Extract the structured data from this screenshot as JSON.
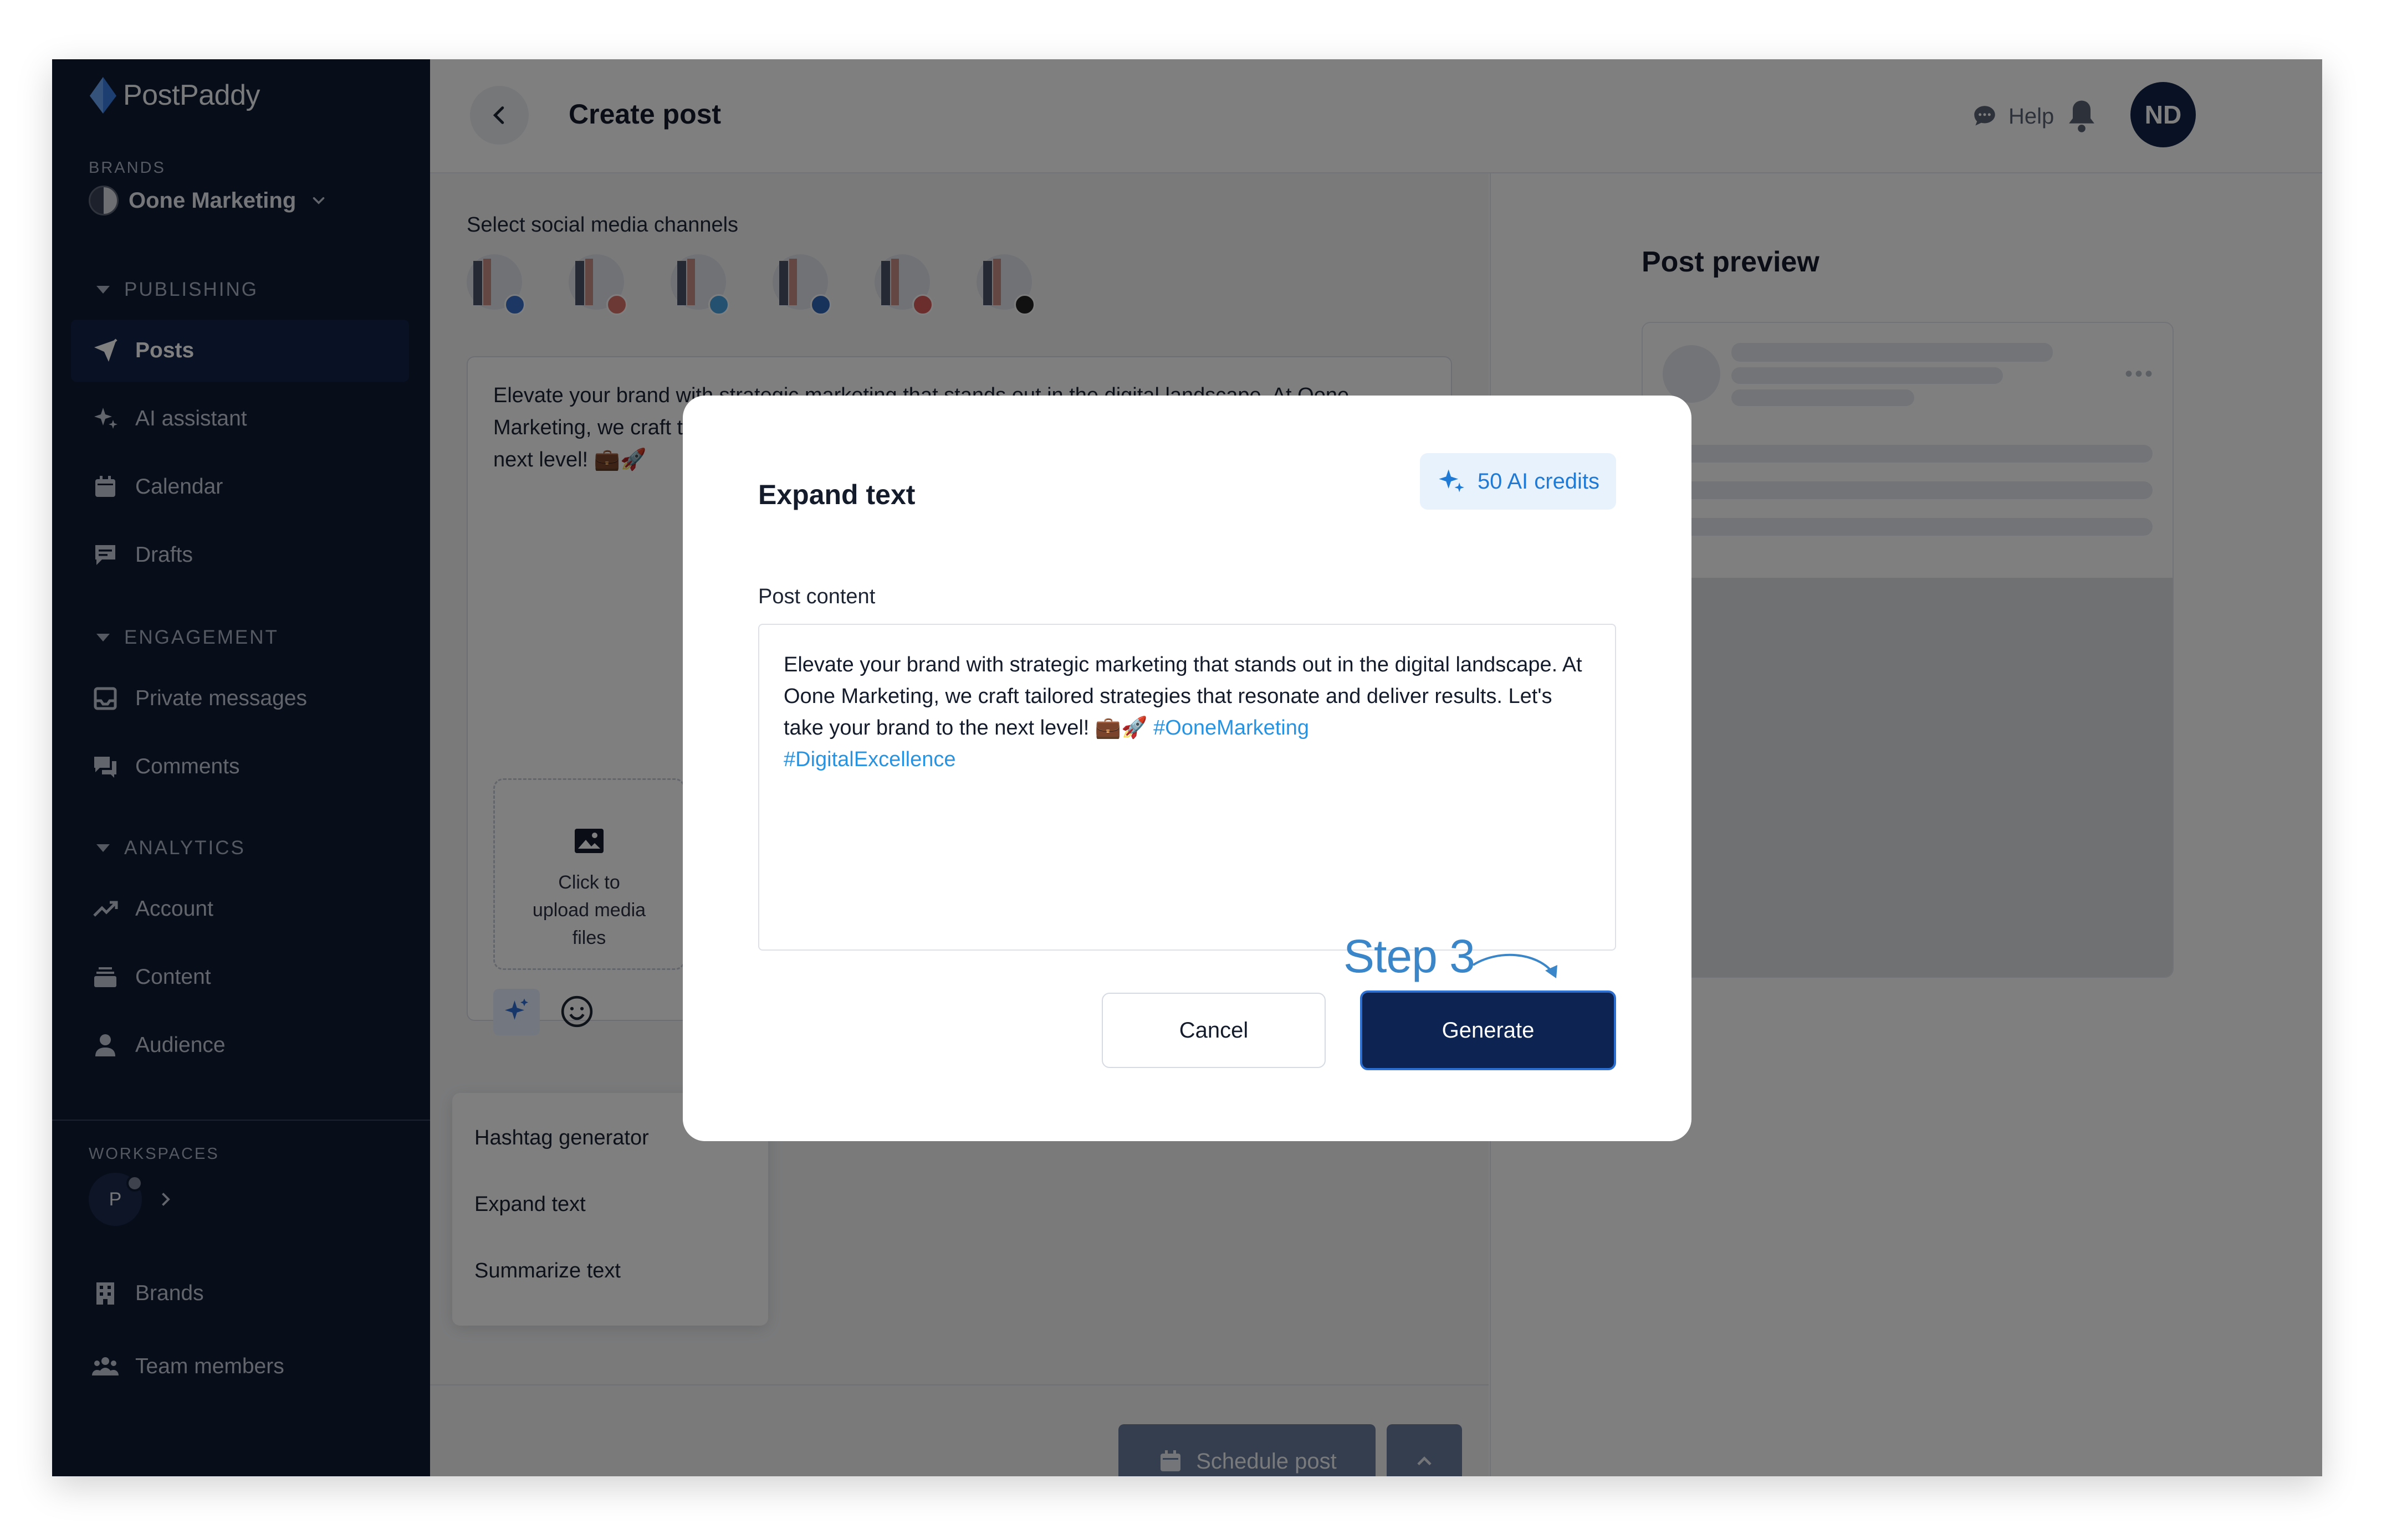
{
  "app": {
    "name": "PostPaddy"
  },
  "sidebar": {
    "brands_label": "BRANDS",
    "brand_name": "Oone Marketing",
    "groups": [
      {
        "title": "PUBLISHING",
        "items": [
          {
            "label": "Posts",
            "icon": "send-icon",
            "active": true
          },
          {
            "label": "AI assistant",
            "icon": "sparkle-icon"
          },
          {
            "label": "Calendar",
            "icon": "calendar-icon"
          },
          {
            "label": "Drafts",
            "icon": "drafts-icon"
          }
        ]
      },
      {
        "title": "ENGAGEMENT",
        "items": [
          {
            "label": "Private messages",
            "icon": "inbox-icon"
          },
          {
            "label": "Comments",
            "icon": "comments-icon"
          }
        ]
      },
      {
        "title": "ANALYTICS",
        "items": [
          {
            "label": "Account",
            "icon": "trend-icon"
          },
          {
            "label": "Content",
            "icon": "stack-icon"
          },
          {
            "label": "Audience",
            "icon": "person-icon"
          }
        ]
      }
    ],
    "workspaces_label": "WORKSPACES",
    "workspace_initial": "P",
    "bottom_items": [
      {
        "label": "Brands",
        "icon": "building-icon"
      },
      {
        "label": "Team members",
        "icon": "team-icon"
      }
    ]
  },
  "header": {
    "title": "Create post",
    "help_label": "Help",
    "user_initials": "ND"
  },
  "main": {
    "channels_label": "Select social media channels",
    "channels": [
      {
        "network": "facebook",
        "badge_color": "#3b6ec9"
      },
      {
        "network": "instagram",
        "badge_color": "#d9736a"
      },
      {
        "network": "twitter",
        "badge_color": "#4aa3e0"
      },
      {
        "network": "linkedin",
        "badge_color": "#2f67b8"
      },
      {
        "network": "youtube",
        "badge_color": "#d95a5a"
      },
      {
        "network": "tiktok",
        "badge_color": "#222222"
      }
    ],
    "editor_text": "Elevate your brand with strategic marketing that stands out in the digital landscape. At Oone Marketing, we craft tailored strategies that resonate and deliver results. Let's take your brand to the next level! 💼🚀",
    "upload_text": "Click to upload media files",
    "ai_menu": [
      "Hashtag generator",
      "Expand text",
      "Summarize text"
    ],
    "schedule_label": "Schedule post"
  },
  "preview": {
    "title": "Post preview"
  },
  "modal": {
    "title": "Expand text",
    "credits": "50 AI credits",
    "field_label": "Post content",
    "content_text": "Elevate your brand with strategic marketing that stands out in the digital landscape. At Oone Marketing, we craft tailored strategies that resonate and deliver results. Let's take your brand to the next level! 💼🚀 ",
    "hashtags": [
      "#OoneMarketing",
      "#DigitalExcellence"
    ],
    "step_label": "Step 3",
    "cancel_label": "Cancel",
    "generate_label": "Generate"
  },
  "colors": {
    "sidebar_bg": "#0f1a33",
    "primary": "#0d2452",
    "accent_blue": "#2a93e0",
    "credits_bg": "#e8f2fc"
  }
}
